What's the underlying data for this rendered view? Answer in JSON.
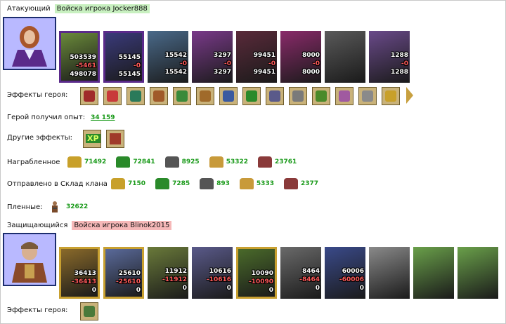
{
  "attacker": {
    "label": "Атакующий",
    "army_label": "Войска игрока Jocker888",
    "units": [
      {
        "n1": "503539",
        "n2": "-5461",
        "n3": "498078",
        "frame": "purple",
        "color": "#6a8a3a"
      },
      {
        "n1": "55145",
        "n2": "-0",
        "n3": "55145",
        "frame": "purple",
        "color": "#3a3a7a"
      },
      {
        "n1": "15542",
        "n2": "-0",
        "n3": "15542",
        "frame": "none",
        "color": "#4a6a8a"
      },
      {
        "n1": "3297",
        "n2": "-0",
        "n3": "3297",
        "frame": "none",
        "color": "#7a3a8a"
      },
      {
        "n1": "99451",
        "n2": "-0",
        "n3": "99451",
        "frame": "none",
        "color": "#5a2a3a"
      },
      {
        "n1": "8000",
        "n2": "-0",
        "n3": "8000",
        "frame": "none",
        "color": "#8a2a6a"
      },
      {
        "n1": "",
        "n2": "",
        "n3": "",
        "frame": "none",
        "color": "#5a5a5a"
      },
      {
        "n1": "1288",
        "n2": "-0",
        "n3": "1288",
        "frame": "none",
        "color": "#6a4a8a"
      }
    ],
    "hero_effects_label": "Эффекты героя:",
    "effects": [
      {
        "icon": "rune-icon",
        "color": "#a02a2a"
      },
      {
        "icon": "dice-icon",
        "color": "#c83a3a"
      },
      {
        "icon": "shield-icon",
        "color": "#2a7a5a"
      },
      {
        "icon": "handshake-icon",
        "color": "#a05a2a"
      },
      {
        "icon": "sword-icon",
        "color": "#3a8a3a"
      },
      {
        "icon": "handshake-icon",
        "color": "#a06a2a"
      },
      {
        "icon": "glove-icon",
        "color": "#3a5aa0"
      },
      {
        "icon": "ring-icon",
        "color": "#2a8a2a"
      },
      {
        "icon": "amulet-icon",
        "color": "#5a5a8a"
      },
      {
        "icon": "armor-icon",
        "color": "#7a7a7a"
      },
      {
        "icon": "ring-icon",
        "color": "#4a8a2a"
      },
      {
        "icon": "flower-icon",
        "color": "#a05aa0"
      },
      {
        "icon": "scimitar-icon",
        "color": "#8a8a8a"
      },
      {
        "icon": "sun-icon",
        "color": "#c8a02a"
      }
    ],
    "experience_label": "Герой получил опыт:",
    "experience_value": "34 159",
    "other_effects_label": "Другие эффекты:",
    "other_effects": [
      {
        "icon": "xp-icon",
        "text": "XP",
        "color": "#2a8a2a"
      },
      {
        "icon": "sword-scroll-icon",
        "text": "",
        "color": "#a03a2a"
      }
    ],
    "looted_label": "Награбленное",
    "looted": [
      {
        "icon": "gold-icon",
        "value": "71492",
        "color": "#c8a02a"
      },
      {
        "icon": "wood-icon",
        "value": "72841",
        "color": "#2a8a2a"
      },
      {
        "icon": "ore-icon",
        "value": "8925",
        "color": "#555555"
      },
      {
        "icon": "wheat-icon",
        "value": "53322",
        "color": "#c89a3a"
      },
      {
        "icon": "clay-icon",
        "value": "23761",
        "color": "#8a3a3a"
      }
    ],
    "sent_label": "Отправлено в Склад клана",
    "sent": [
      {
        "icon": "gold-icon",
        "value": "7150",
        "color": "#c8a02a"
      },
      {
        "icon": "wood-icon",
        "value": "7285",
        "color": "#2a8a2a"
      },
      {
        "icon": "ore-icon",
        "value": "893",
        "color": "#555555"
      },
      {
        "icon": "wheat-icon",
        "value": "5333",
        "color": "#c89a3a"
      },
      {
        "icon": "clay-icon",
        "value": "2377",
        "color": "#8a3a3a"
      }
    ],
    "prisoners_label": "Пленные:",
    "prisoners_value": "32622"
  },
  "defender": {
    "label": "Защищающийся",
    "army_label": "Войска игрока Blinok2015",
    "units": [
      {
        "n1": "36413",
        "n2": "-36413",
        "n3": "0",
        "frame": "gold",
        "color": "#8a6a2a"
      },
      {
        "n1": "25610",
        "n2": "-25610",
        "n3": "0",
        "frame": "gold",
        "color": "#5a6a9a"
      },
      {
        "n1": "11912",
        "n2": "-11912",
        "n3": "0",
        "frame": "none",
        "color": "#6a7a3a"
      },
      {
        "n1": "10616",
        "n2": "-10616",
        "n3": "0",
        "frame": "none",
        "color": "#5a5a8a"
      },
      {
        "n1": "10090",
        "n2": "-10090",
        "n3": "0",
        "frame": "gold",
        "color": "#4a6a2a"
      },
      {
        "n1": "8464",
        "n2": "-8464",
        "n3": "0",
        "frame": "none",
        "color": "#6a6a6a"
      },
      {
        "n1": "60006",
        "n2": "-60006",
        "n3": "0",
        "frame": "none",
        "color": "#3a4a8a"
      },
      {
        "n1": "",
        "n2": "",
        "n3": "",
        "frame": "none",
        "color": "#8a8a8a"
      },
      {
        "n1": "",
        "n2": "",
        "n3": "",
        "frame": "none",
        "color": "#6aa04a"
      },
      {
        "n1": "",
        "n2": "",
        "n3": "",
        "frame": "none",
        "color": "#6aa04a"
      }
    ],
    "hero_effects_label": "Эффекты героя:",
    "effects": [
      {
        "icon": "scroll-icon",
        "color": "#4a7a3a"
      }
    ]
  },
  "colors": {
    "green_value": "#1a9a1a",
    "loss_red": "#ff5a5a",
    "hero_bg": "#b9b9ff"
  }
}
